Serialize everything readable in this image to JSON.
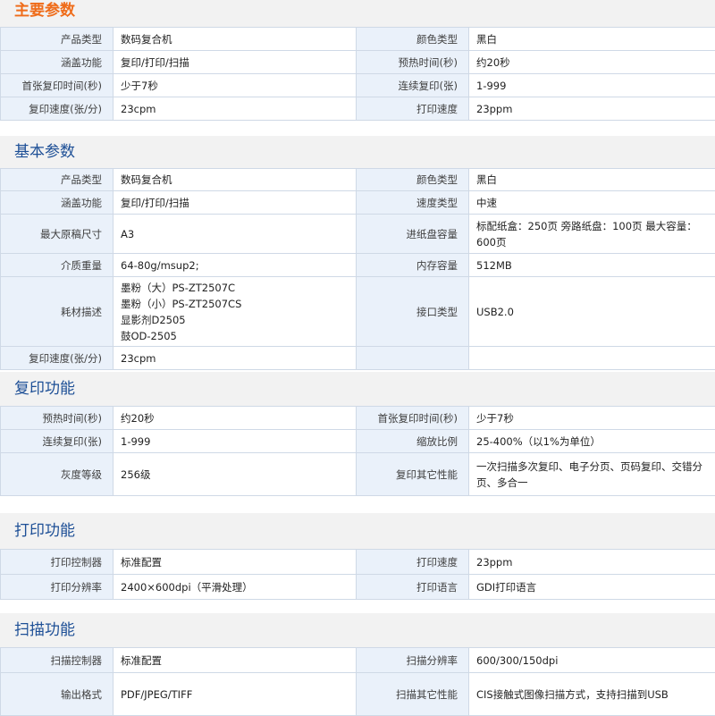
{
  "sections": {
    "main": {
      "title": "主要参数",
      "rows": [
        [
          "产品类型",
          "数码复合机",
          "颜色类型",
          "黑白"
        ],
        [
          "涵盖功能",
          "复印/打印/扫描",
          "预热时间(秒)",
          "约20秒"
        ],
        [
          "首张复印时间(秒)",
          "少于7秒",
          "连续复印(张)",
          "1-999"
        ],
        [
          "复印速度(张/分)",
          "23cpm",
          "打印速度",
          "23ppm"
        ]
      ]
    },
    "basic": {
      "title": "基本参数",
      "rows": [
        [
          "产品类型",
          "数码复合机",
          "颜色类型",
          "黑白"
        ],
        [
          "涵盖功能",
          "复印/打印/扫描",
          "速度类型",
          "中速"
        ],
        [
          "最大原稿尺寸",
          "A3",
          "进纸盘容量",
          "标配纸盒：250页 旁路纸盘：100页 最大容量：600页"
        ],
        [
          "介质重量",
          "64-80g/msup2;",
          "内存容量",
          "512MB"
        ],
        [
          "耗材描述",
          "墨粉（大）PS-ZT2507C\n墨粉（小）PS-ZT2507CS\n显影剂D2505\n鼓OD-2505",
          "接口类型",
          "USB2.0"
        ],
        [
          "复印速度(张/分)",
          "23cpm",
          "",
          ""
        ]
      ]
    },
    "copy": {
      "title": "复印功能",
      "rows": [
        [
          "预热时间(秒)",
          "约20秒",
          "首张复印时间(秒)",
          "少于7秒"
        ],
        [
          "连续复印(张)",
          "1-999",
          "缩放比例",
          "25-400%（以1%为单位）"
        ],
        [
          "灰度等级",
          "256级",
          "复印其它性能",
          "一次扫描多次复印、电子分页、页码复印、交错分页、多合一"
        ]
      ]
    },
    "print": {
      "title": "打印功能",
      "rows": [
        [
          "打印控制器",
          "标准配置",
          "打印速度",
          "23ppm"
        ],
        [
          "打印分辨率",
          "2400×600dpi（平滑处理）",
          "打印语言",
          "GDI打印语言"
        ]
      ]
    },
    "scan": {
      "title": "扫描功能",
      "rows": [
        [
          "扫描控制器",
          "标准配置",
          "扫描分辨率",
          "600/300/150dpi"
        ],
        [
          "输出格式",
          "PDF/JPEG/TIFF",
          "扫描其它性能",
          "CIS接触式图像扫描方式，支持扫描到USB"
        ]
      ]
    }
  }
}
